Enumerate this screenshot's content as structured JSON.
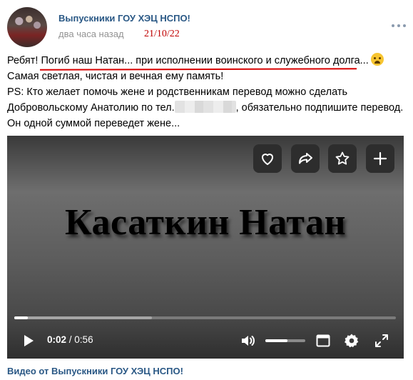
{
  "post": {
    "author": "Выпускники ГОУ ХЭЦ НСПО!",
    "time_ago": "два часа назад",
    "handwritten_date": "21/10/22",
    "text_lines": [
      "Ребят! Погиб наш Натан... при исполнении воинского и служебного долга...",
      "Самая светлая, чистая и вечная ему память!",
      "PS: Кто желает помочь жене и родственникам перевод можно сделать",
      "Добровольскому Анатолию по тел.",
      ", обязательно подпишите перевод.",
      "Он одной суммой переведет жене..."
    ],
    "emoji": "crying-face-emoji",
    "accent_color": "#2a5885",
    "annotation_color": "#d80000"
  },
  "video": {
    "title": "Касаткин Натан",
    "current_time": "0:02",
    "separator": " / ",
    "duration": "0:56",
    "progress_fraction": 0.036,
    "buffered_fraction": 0.36,
    "volume_fraction": 0.55,
    "actions": [
      "heart-icon",
      "share-icon",
      "star-icon",
      "plus-icon"
    ],
    "caption": "Видео от Выпускники ГОУ ХЭЦ НСПО!"
  }
}
